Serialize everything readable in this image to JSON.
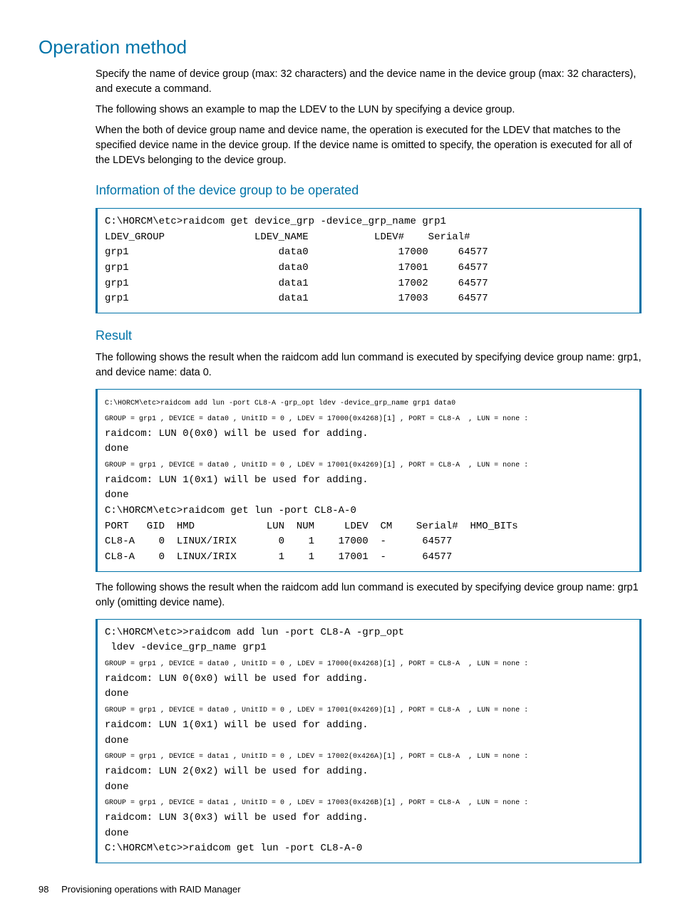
{
  "heading": "Operation method",
  "para1": "Specify the name of device group (max: 32 characters) and the device name in the device group (max: 32 characters), and execute a command.",
  "para2": "The following shows an example to map the LDEV to the LUN by specifying a device group.",
  "para3": "When the both of device group name and device name, the operation is executed for the LDEV that matches to the specified device name in the device group. If the device name is omitted to specify, the operation is executed for all of the LDEVs belonging to the device group.",
  "sub1": "Information of the device group to be operated",
  "code1": "C:\\HORCM\\etc>raidcom get device_grp -device_grp_name grp1\nLDEV_GROUP               LDEV_NAME           LDEV#    Serial#\ngrp1                         data0               17000     64577\ngrp1                         data0               17001     64577\ngrp1                         data1               17002     64577\ngrp1                         data1               17003     64577",
  "sub2": "Result",
  "para4": "The following shows the result when the raidcom add lun command is executed by specifying device group name: grp1, and device name: data 0.",
  "code2_l1": "C:\\HORCM\\etc>raidcom add lun -port CL8-A -grp_opt ldev -device_grp_name grp1 data0",
  "code2_l2": "GROUP = grp1 , DEVICE = data0 , UnitID = 0 , LDEV = 17000(0x4268)[1] , PORT = CL8-A  , LUN = none :",
  "code2_l3": "raidcom: LUN 0(0x0) will be used for adding.",
  "code2_l4": "done",
  "code2_l5": "GROUP = grp1 , DEVICE = data0 , UnitID = 0 , LDEV = 17001(0x4269)[1] , PORT = CL8-A  , LUN = none :",
  "code2_l6": "raidcom: LUN 1(0x1) will be used for adding.",
  "code2_l7": "done",
  "code2_l8": "C:\\HORCM\\etc>raidcom get lun -port CL8-A-0",
  "code2_l9": "PORT   GID  HMD            LUN  NUM     LDEV  CM    Serial#  HMO_BITs",
  "code2_l10": "CL8-A    0  LINUX/IRIX       0    1    17000  -      64577",
  "code2_l11": "CL8-A    0  LINUX/IRIX       1    1    17001  -      64577",
  "para5": "The following shows the result when the raidcom add lun command is executed by specifying device group name: grp1 only (omitting device name).",
  "code3_l1": "C:\\HORCM\\etc>>raidcom add lun -port CL8-A -grp_opt",
  "code3_l2": " ldev -device_grp_name grp1",
  "code3_l3": "GROUP = grp1 , DEVICE = data0 , UnitID = 0 , LDEV = 17000(0x4268)[1] , PORT = CL8-A  , LUN = none :",
  "code3_l4": "raidcom: LUN 0(0x0) will be used for adding.",
  "code3_l5": "done",
  "code3_l6": "GROUP = grp1 , DEVICE = data0 , UnitID = 0 , LDEV = 17001(0x4269)[1] , PORT = CL8-A  , LUN = none :",
  "code3_l7": "raidcom: LUN 1(0x1) will be used for adding.",
  "code3_l8": "done",
  "code3_l9": "GROUP = grp1 , DEVICE = data1 , UnitID = 0 , LDEV = 17002(0x426A)[1] , PORT = CL8-A  , LUN = none :",
  "code3_l10": "raidcom: LUN 2(0x2) will be used for adding.",
  "code3_l11": "done",
  "code3_l12": "GROUP = grp1 , DEVICE = data1 , UnitID = 0 , LDEV = 17003(0x426B)[1] , PORT = CL8-A  , LUN = none :",
  "code3_l13": "raidcom: LUN 3(0x3) will be used for adding.",
  "code3_l14": "done",
  "code3_l15": "C:\\HORCM\\etc>>raidcom get lun -port CL8-A-0",
  "footer_page": "98",
  "footer_text": "Provisioning operations with RAID Manager"
}
